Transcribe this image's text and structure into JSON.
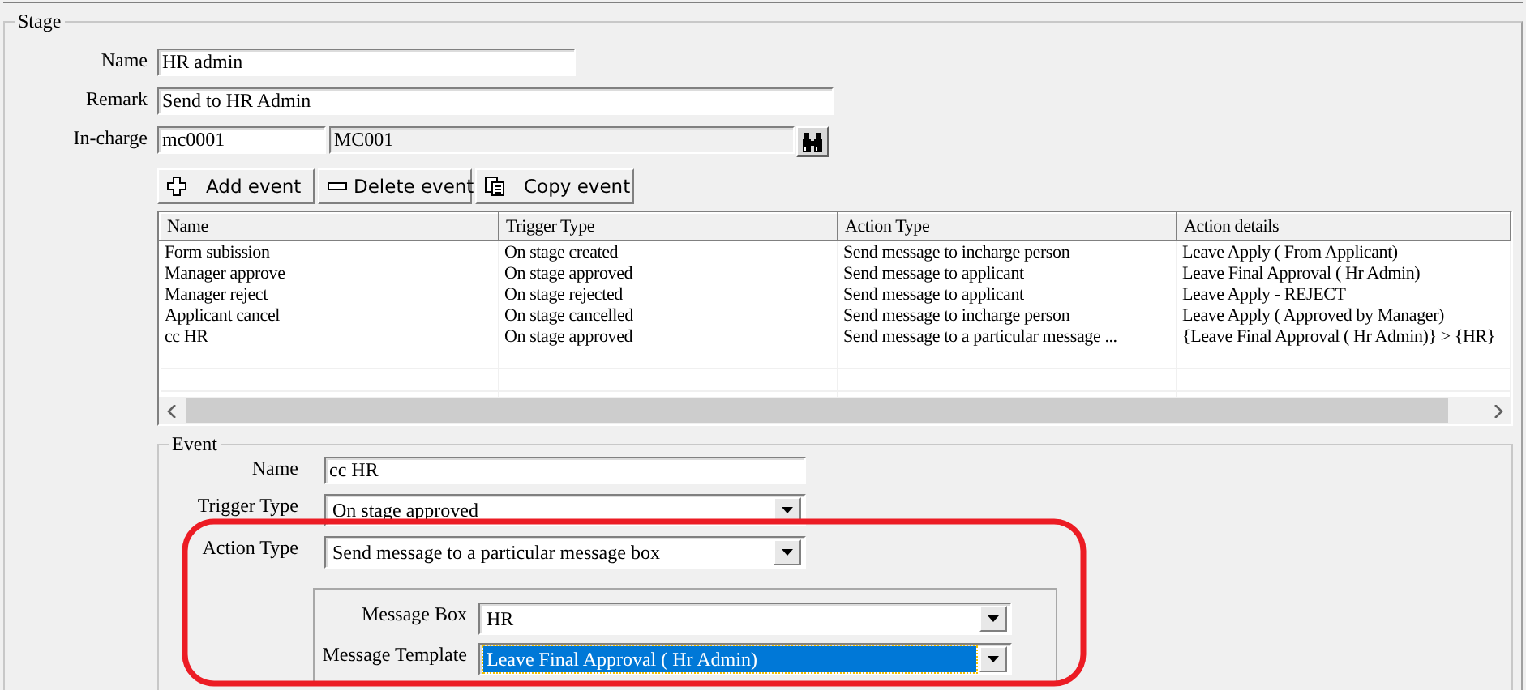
{
  "stage": {
    "title": "Stage",
    "fields": [
      {
        "label": "Name",
        "value": "HR admin"
      },
      {
        "label": "Remark",
        "value": "Send to HR Admin"
      }
    ],
    "in_charge": {
      "label": "In-charge",
      "code": "mc0001",
      "name": "MC001"
    }
  },
  "toolbar": [
    {
      "label": "Add event",
      "kind": "add"
    },
    {
      "label": "Delete event",
      "kind": "delete"
    },
    {
      "label": "Copy event",
      "kind": "copy"
    }
  ],
  "events_table": {
    "columns": [
      "Name",
      "Trigger Type",
      "Action Type",
      "Action details"
    ],
    "rows": [
      [
        "Form subission",
        "On stage created",
        "Send message to incharge person",
        "Leave Apply ( From Applicant)"
      ],
      [
        "Manager approve",
        "On stage approved",
        "Send message to applicant",
        "Leave Final Approval ( Hr Admin)"
      ],
      [
        "Manager reject",
        "On stage rejected",
        "Send message to applicant",
        "Leave Apply - REJECT"
      ],
      [
        "Applicant cancel",
        "On stage cancelled",
        "Send message to incharge person",
        "Leave Apply ( Approved by Manager)"
      ],
      [
        "cc HR",
        "On stage approved",
        "Send message to a particular message ...",
        "{Leave Final Approval ( Hr Admin)} > {HR}"
      ]
    ]
  },
  "event": {
    "title": "Event",
    "fields": [
      {
        "label": "Name",
        "value": "cc HR",
        "kind": "text"
      },
      {
        "label": "Trigger Type",
        "value": "On stage approved",
        "kind": "dropdown"
      },
      {
        "label": "Action Type",
        "value": "Send message to a particular message box",
        "kind": "dropdown"
      }
    ],
    "message": [
      {
        "label": "Message Box",
        "value": "HR",
        "selected": false
      },
      {
        "label": "Message Template",
        "value": "Leave Final Approval ( Hr Admin)",
        "selected": true
      }
    ]
  }
}
